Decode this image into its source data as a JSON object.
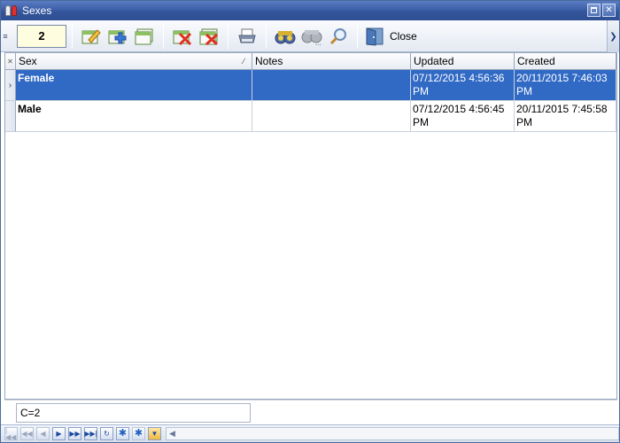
{
  "window": {
    "title": "Sexes"
  },
  "toolbar": {
    "record_number": "2",
    "tools": [
      {
        "name": "edit-record-icon"
      },
      {
        "name": "add-record-icon"
      },
      {
        "name": "add-copy-icon"
      },
      {
        "name": "delete-record-icon"
      },
      {
        "name": "delete-all-icon"
      },
      {
        "name": "print-icon"
      },
      {
        "name": "find-icon"
      },
      {
        "name": "find-next-icon"
      },
      {
        "name": "search-icon"
      }
    ],
    "close_label": "Close"
  },
  "grid": {
    "columns": [
      "Sex",
      "Notes",
      "Updated",
      "Created"
    ],
    "rows": [
      {
        "sex": "Female",
        "notes": "",
        "updated": "07/12/2015 4:56:36 PM",
        "created": "20/11/2015 7:46:03 PM"
      },
      {
        "sex": "Male",
        "notes": "",
        "updated": "07/12/2015 4:56:45 PM",
        "created": "20/11/2015 7:45:58 PM"
      }
    ]
  },
  "footer": {
    "count": "C=2"
  },
  "colors": {
    "selection": "#316ac5",
    "title_bar": "#3d5fa8",
    "record_box": "#fffde0"
  }
}
